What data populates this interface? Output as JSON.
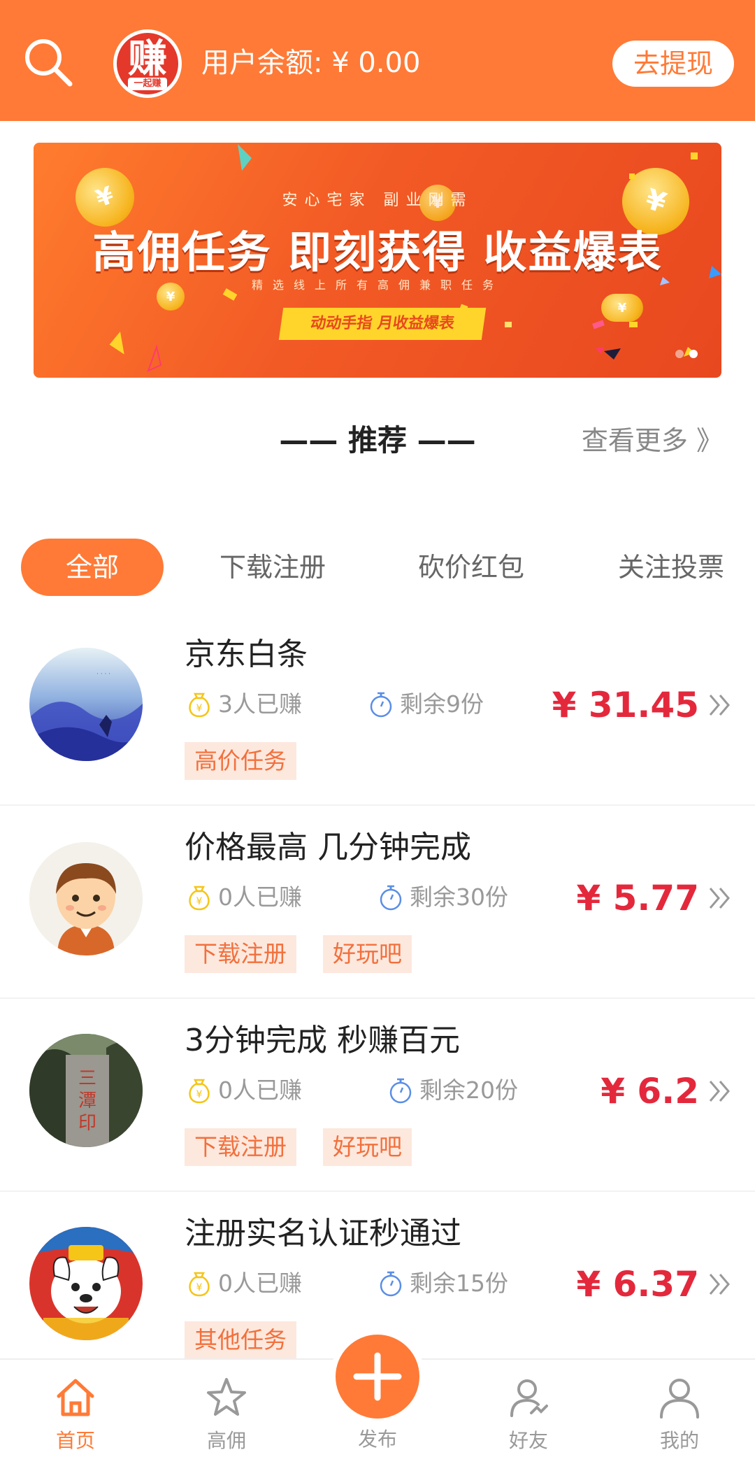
{
  "header": {
    "logo_char": "赚",
    "logo_sub": "一起赚",
    "balance_label": "用户余额: ¥ 0.00",
    "withdraw_label": "去提现",
    "brand_color": "#ff7a36"
  },
  "banner": {
    "subtitle": "安心宅家  副业刚需",
    "title": "高佣任务 即刻获得 收益爆表",
    "line": "精选线上所有高佣兼职任务",
    "tag": "动动手指 月收益爆表",
    "coin_symbol": "¥"
  },
  "section": {
    "title": "—— 推荐 ——",
    "more_label": "查看更多 》"
  },
  "tabs": [
    "全部",
    "下载注册",
    "砍价红包",
    "关注投票"
  ],
  "tasks": [
    {
      "title": "京东白条",
      "earned": "3人已赚",
      "remaining": "剩余9份",
      "price": "¥ 31.45",
      "tags": [
        "高价任务"
      ]
    },
    {
      "title": "价格最高 几分钟完成",
      "earned": "0人已赚",
      "remaining": "剩余30份",
      "price": "¥ 5.77",
      "tags": [
        "下载注册",
        "好玩吧"
      ]
    },
    {
      "title": "3分钟完成 秒赚百元",
      "earned": "0人已赚",
      "remaining": "剩余20份",
      "price": "¥ 6.2",
      "tags": [
        "下载注册",
        "好玩吧"
      ]
    },
    {
      "title": "注册实名认证秒通过",
      "earned": "0人已赚",
      "remaining": "剩余15份",
      "price": "¥ 6.37",
      "tags": [
        "其他任务"
      ]
    }
  ],
  "bottom_nav": {
    "home": "首页",
    "high_commission": "高佣",
    "publish": "发布",
    "friends": "好友",
    "mine": "我的"
  },
  "icons": {
    "search": "search-icon",
    "money_bag": "money-bag-icon",
    "timer": "stopwatch-icon",
    "chevron": "double-chevron-right-icon",
    "home": "home-icon",
    "star": "star-icon",
    "plus": "plus-icon",
    "friend": "friend-icon",
    "user": "user-icon"
  },
  "colors": {
    "accent": "#ff7a36",
    "price": "#e4283c",
    "tag_bg": "#fde8de",
    "tag_text": "#f2703c"
  }
}
